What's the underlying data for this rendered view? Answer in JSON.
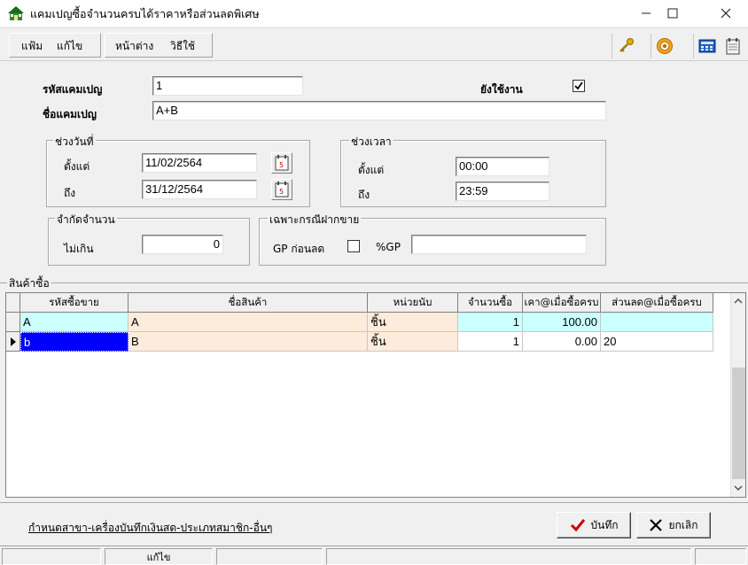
{
  "window": {
    "title": "แคมเปญซื้อจำนวนครบได้ราคาหรือส่วนลดพิเศษ",
    "icon": "house-icon"
  },
  "menu": {
    "file": "แฟ้ม",
    "edit": "แก้ไข",
    "window": "หน้าต่าง",
    "howto": "วิธีใช้"
  },
  "form": {
    "code_label": "รหัสแคมเปญ",
    "code_value": "1",
    "name_label": "ชื่อแคมเปญ",
    "name_value": "A+B",
    "active_label": "ยังใช้งาน",
    "active_checked": true
  },
  "date_range": {
    "legend": "ช่วงวันที่",
    "from_label": "ตั้งแต่",
    "from_value": "11/02/2564",
    "to_label": "ถึง",
    "to_value": "31/12/2564"
  },
  "time_range": {
    "legend": "ช่วงเวลา",
    "from_label": "ตั้งแต่",
    "from_value": "00:00",
    "to_label": "ถึง",
    "to_value": "23:59"
  },
  "limit": {
    "legend": "จำกัดจำนวน",
    "max_label": "ไม่เกิน",
    "max_value": "0"
  },
  "consign": {
    "legend": "เฉพาะกรณีฝากขาย",
    "gp_before_label": "GP ก่อนลด",
    "gp_before_checked": false,
    "gp_pct_label": "%GP",
    "gp_pct_value": ""
  },
  "products": {
    "legend": "สินค้าซื้อ",
    "columns": [
      "รหัสซื้อขาย",
      "ชื่อสินค้า",
      "หน่วยนับ",
      "จำนวนซื้อ",
      "เคา@เมื่อซื้อครบ",
      "ส่วนลด@เมื่อซื้อครบ"
    ],
    "rows": [
      {
        "code": "A",
        "name": "A",
        "unit": "ชิ้น",
        "qty": "1",
        "price": "100.00",
        "discount": ""
      },
      {
        "code": "b",
        "name": "B",
        "unit": "ชิ้น",
        "qty": "1",
        "price": "0.00",
        "discount": "20"
      }
    ]
  },
  "footer": {
    "link": "กำหนดสาขา-เครื่องบันทึกเงินสด-ประเภทสมาชิก-อื่นๆ",
    "save": "บันทึก",
    "cancel": "ยกเลิก"
  },
  "status": {
    "mode": "แก้ไข"
  },
  "colors": {
    "selected_row": "#0000ff",
    "name_cell": "#fdebdc",
    "qty_row1": "#ccffff",
    "save_check": "#cc0000"
  }
}
